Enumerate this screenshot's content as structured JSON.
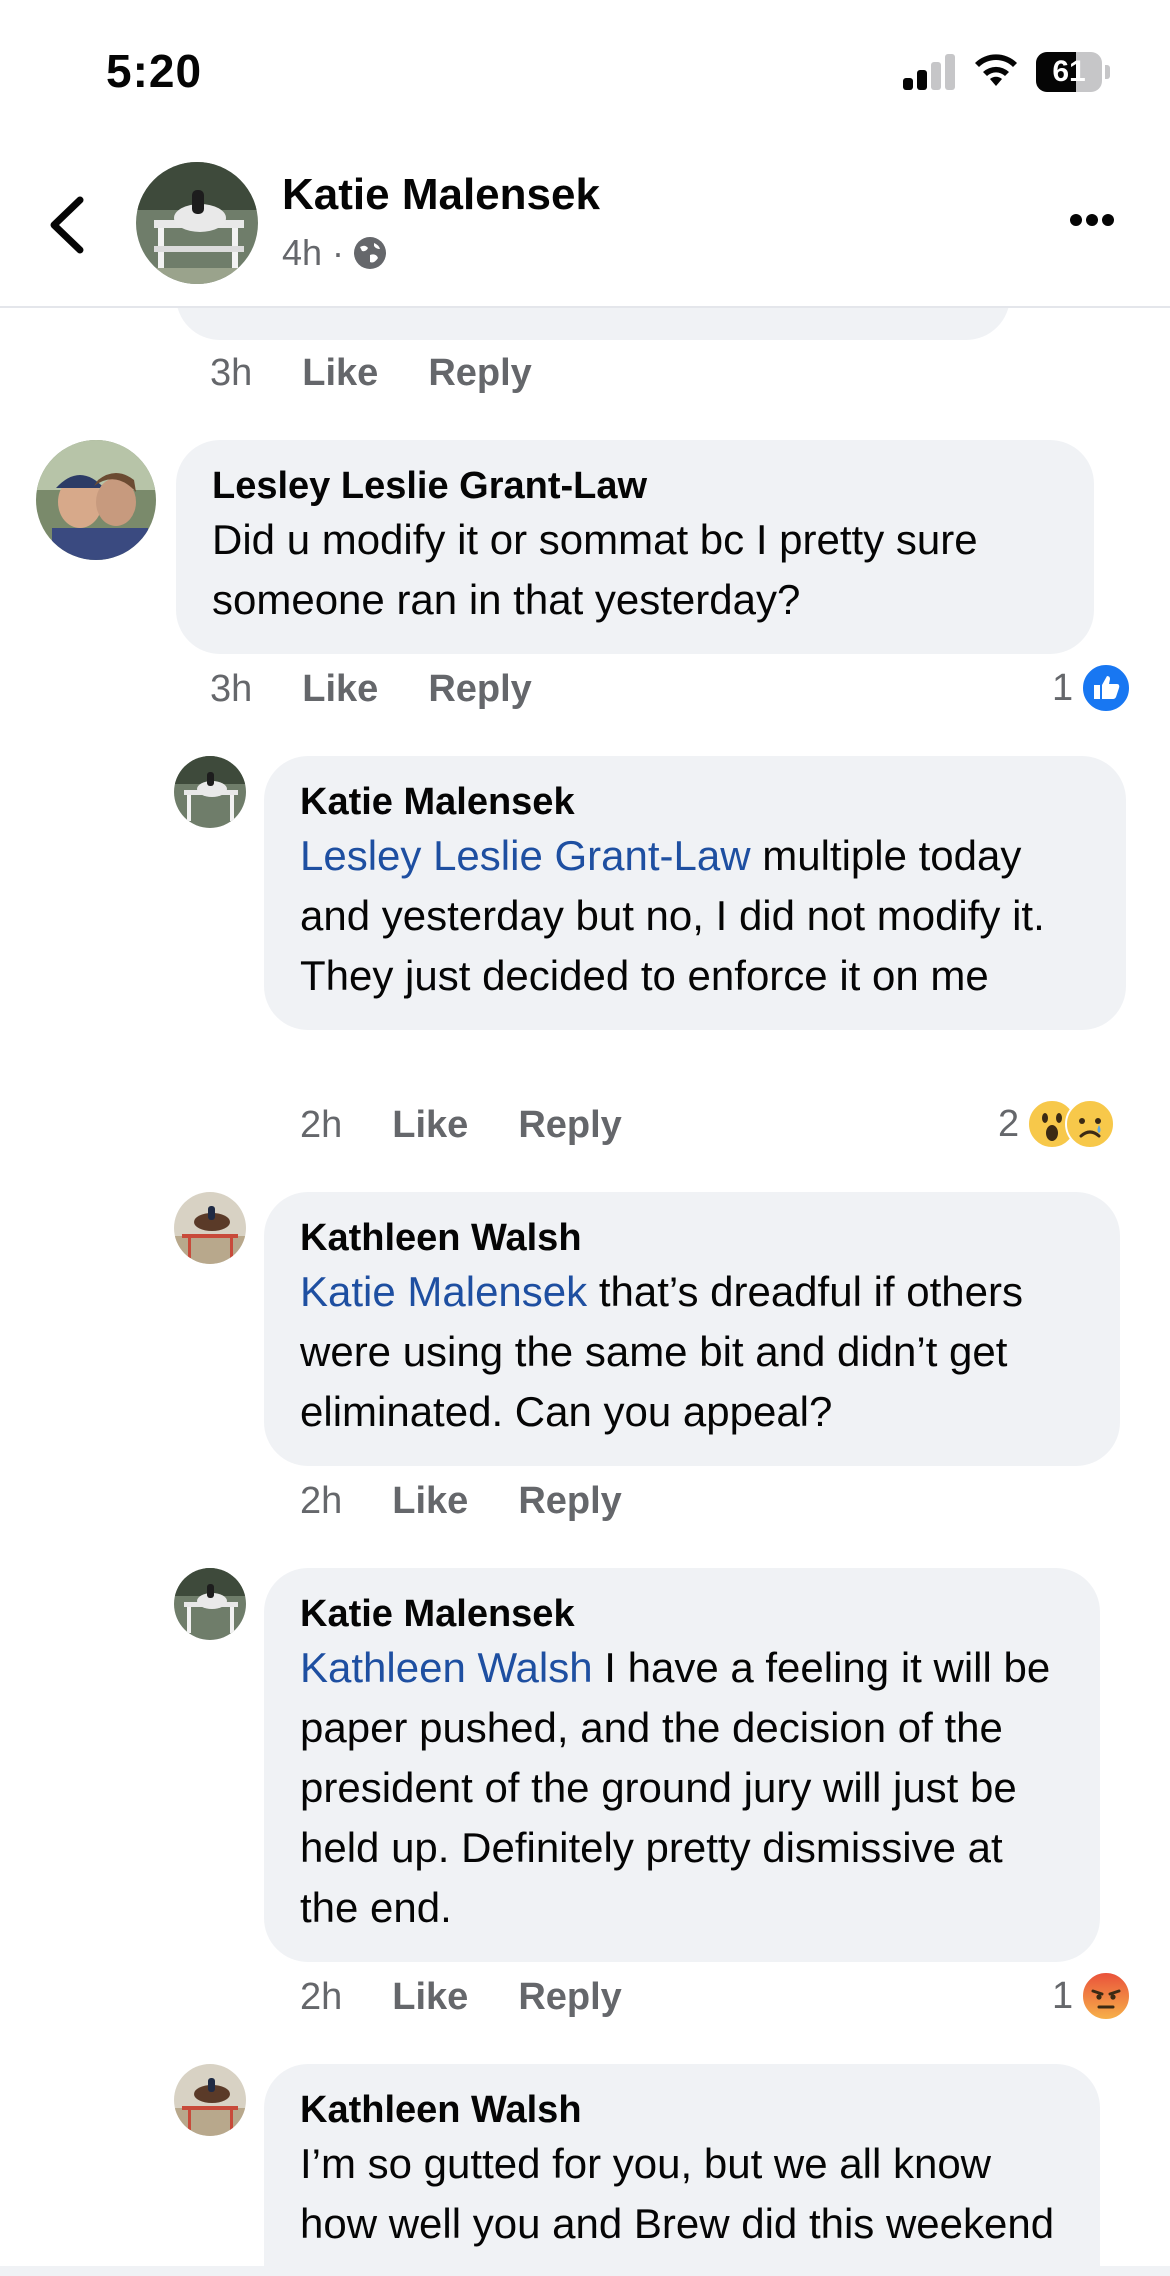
{
  "status_bar": {
    "time": "5:20",
    "battery": "61",
    "battery_level": 0.61
  },
  "header": {
    "name": "Katie Malensek",
    "meta": "4h ·",
    "icons": [
      "back-arrow-icon",
      "globe-icon",
      "more-icon"
    ]
  },
  "previous_comment": {
    "time": "3h",
    "like": "Like",
    "reply": "Reply"
  },
  "comments": [
    {
      "author": "Lesley Leslie Grant-Law",
      "text": "Did u modify it or sommat bc I pretty sure someone ran in that yesterday?",
      "time": "3h",
      "like": "Like",
      "reply": "Reply",
      "reaction_count": "1",
      "reaction_icons": [
        "like-reaction-icon"
      ]
    },
    {
      "author": "Katie Malensek",
      "mention": "Lesley Leslie Grant-Law",
      "text": " multiple today and yesterday but no, I did not modify it. They just decided to enforce it  on me",
      "time": "2h",
      "like": "Like",
      "reply": "Reply",
      "reaction_count": "2",
      "reaction_icons": [
        "wow-reaction-icon",
        "sad-reaction-icon"
      ]
    },
    {
      "author": "Kathleen Walsh",
      "mention": "Katie Malensek",
      "text": " that’s dreadful if others were using the same bit and didn’t get eliminated. Can you appeal?",
      "time": "2h",
      "like": "Like",
      "reply": "Reply"
    },
    {
      "author": "Katie Malensek",
      "mention": "Kathleen Walsh",
      "text": " I have a feeling it will be paper pushed, and the decision of the president of the ground jury will just be held up. Definitely pretty dismissive at the end.",
      "time": "2h",
      "like": "Like",
      "reply": "Reply",
      "reaction_count": "1",
      "reaction_icons": [
        "angry-reaction-icon"
      ]
    },
    {
      "author": "Kathleen Walsh",
      "text": "I’m so gutted for you, but we all know how well you and Brew did this weekend"
    }
  ],
  "colors": {
    "bubble": "#f0f2f5",
    "mention": "#1e4fa1",
    "secondary_text": "#65676b",
    "like_blue": "#1877f2"
  }
}
